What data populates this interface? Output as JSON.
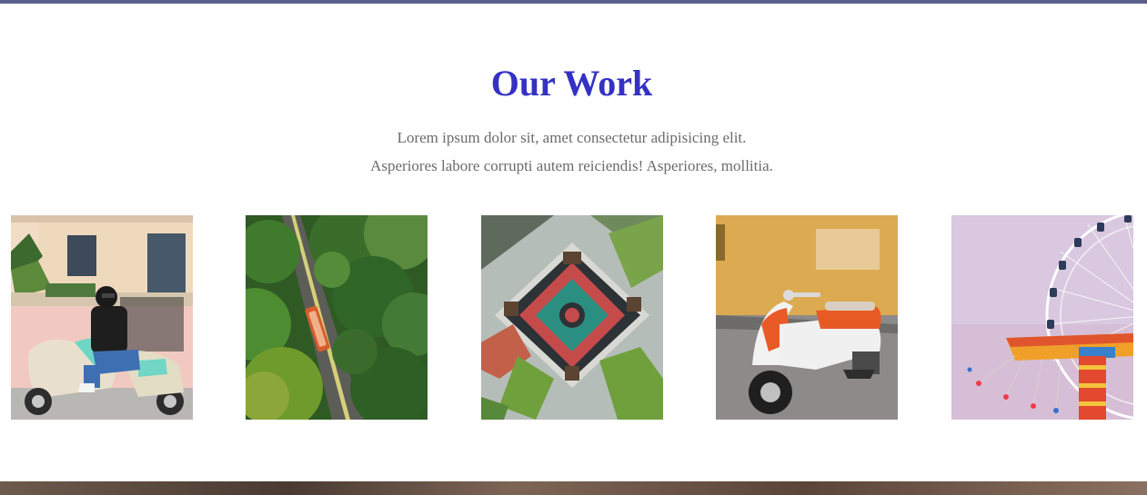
{
  "work": {
    "title": "Our Work",
    "description_lines": [
      "Lorem ipsum dolor sit, amet consectetur adipisicing elit.",
      "Asperiores labore corrupti autem reiciendis! Asperiores, mollitia."
    ]
  },
  "gallery": [
    {
      "subject": "woman riding mint scooter"
    },
    {
      "subject": "aerial road through trees"
    },
    {
      "subject": "aerial playground"
    },
    {
      "subject": "orange white vintage scooter"
    },
    {
      "subject": "ferris wheel and swing ride"
    }
  ],
  "colors": {
    "accent": "#3431c4",
    "top_bar": "#5b5f8e",
    "text_muted": "#6b6b6b"
  }
}
